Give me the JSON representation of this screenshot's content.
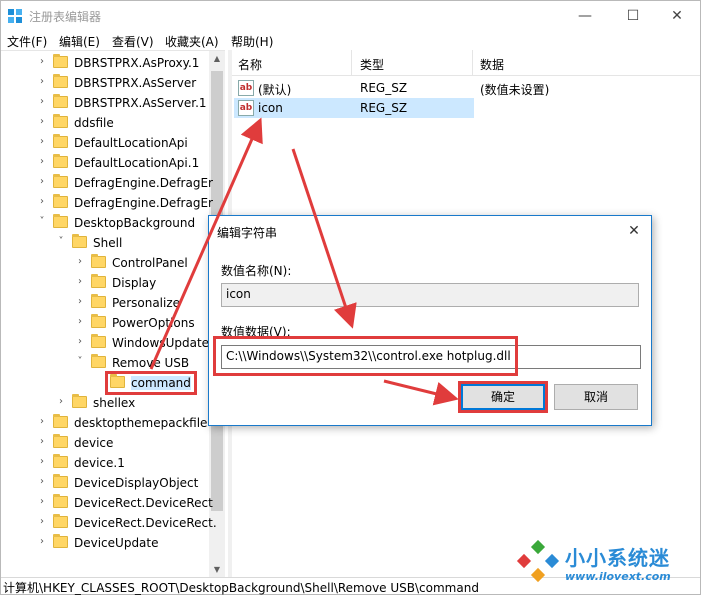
{
  "window": {
    "title": "注册表编辑器",
    "controls": {
      "minimize": "—",
      "maximize": "☐",
      "close": "✕"
    }
  },
  "menu": [
    "文件(F)",
    "编辑(E)",
    "查看(V)",
    "收藏夹(A)",
    "帮助(H)"
  ],
  "tree": {
    "items": [
      {
        "label": "DBRSTPRX.AsProxy.1",
        "expander": "›"
      },
      {
        "label": "DBRSTPRX.AsServer",
        "expander": "›"
      },
      {
        "label": "DBRSTPRX.AsServer.1",
        "expander": "›"
      },
      {
        "label": "ddsfile",
        "expander": "›"
      },
      {
        "label": "DefaultLocationApi",
        "expander": "›"
      },
      {
        "label": "DefaultLocationApi.1",
        "expander": "›"
      },
      {
        "label": "DefragEngine.DefragEr",
        "expander": "›"
      },
      {
        "label": "DefragEngine.DefragEr",
        "expander": "›"
      },
      {
        "label": "DesktopBackground",
        "expander": "˅"
      },
      {
        "label": "Shell",
        "expander": "˅"
      },
      {
        "label": "ControlPanel",
        "expander": "›"
      },
      {
        "label": "Display",
        "expander": "›"
      },
      {
        "label": "Personalize",
        "expander": "›"
      },
      {
        "label": "PowerOptions",
        "expander": "›"
      },
      {
        "label": "WindowsUpdate",
        "expander": "›"
      },
      {
        "label": "Remove USB",
        "expander": "˅"
      },
      {
        "label": "command",
        "expander": ""
      },
      {
        "label": "shellex",
        "expander": "›"
      },
      {
        "label": "desktopthemepackfile",
        "expander": "›"
      },
      {
        "label": "device",
        "expander": "›"
      },
      {
        "label": "device.1",
        "expander": "›"
      },
      {
        "label": "DeviceDisplayObject",
        "expander": "›"
      },
      {
        "label": "DeviceRect.DeviceRect",
        "expander": "›"
      },
      {
        "label": "DeviceRect.DeviceRect.",
        "expander": "›"
      },
      {
        "label": "DeviceUpdate",
        "expander": "›"
      }
    ]
  },
  "list": {
    "headers": {
      "name": "名称",
      "type": "类型",
      "data": "数据"
    },
    "icon_glyph": "ab",
    "rows": [
      {
        "name": "(默认)",
        "type": "REG_SZ",
        "data": "(数值未设置)"
      },
      {
        "name": "icon",
        "type": "REG_SZ",
        "data": ""
      }
    ]
  },
  "status": "计算机\\HKEY_CLASSES_ROOT\\DesktopBackground\\Shell\\Remove USB\\command",
  "dialog": {
    "title": "编辑字符串",
    "close": "✕",
    "name_label": "数值名称(N):",
    "name_value": "icon",
    "data_label": "数值数据(V):",
    "data_value": "C:\\\\Windows\\\\System32\\\\control.exe hotplug.dll",
    "ok": "确定",
    "cancel": "取消"
  },
  "watermark": {
    "text": "小小系统迷",
    "url": "www.ilovext.com"
  },
  "colors": {
    "selection": "#cce8ff",
    "accent": "#0078d7",
    "annotation": "#e03c3c",
    "watermark": "#2a8bd6",
    "folder": "#ffd665"
  }
}
